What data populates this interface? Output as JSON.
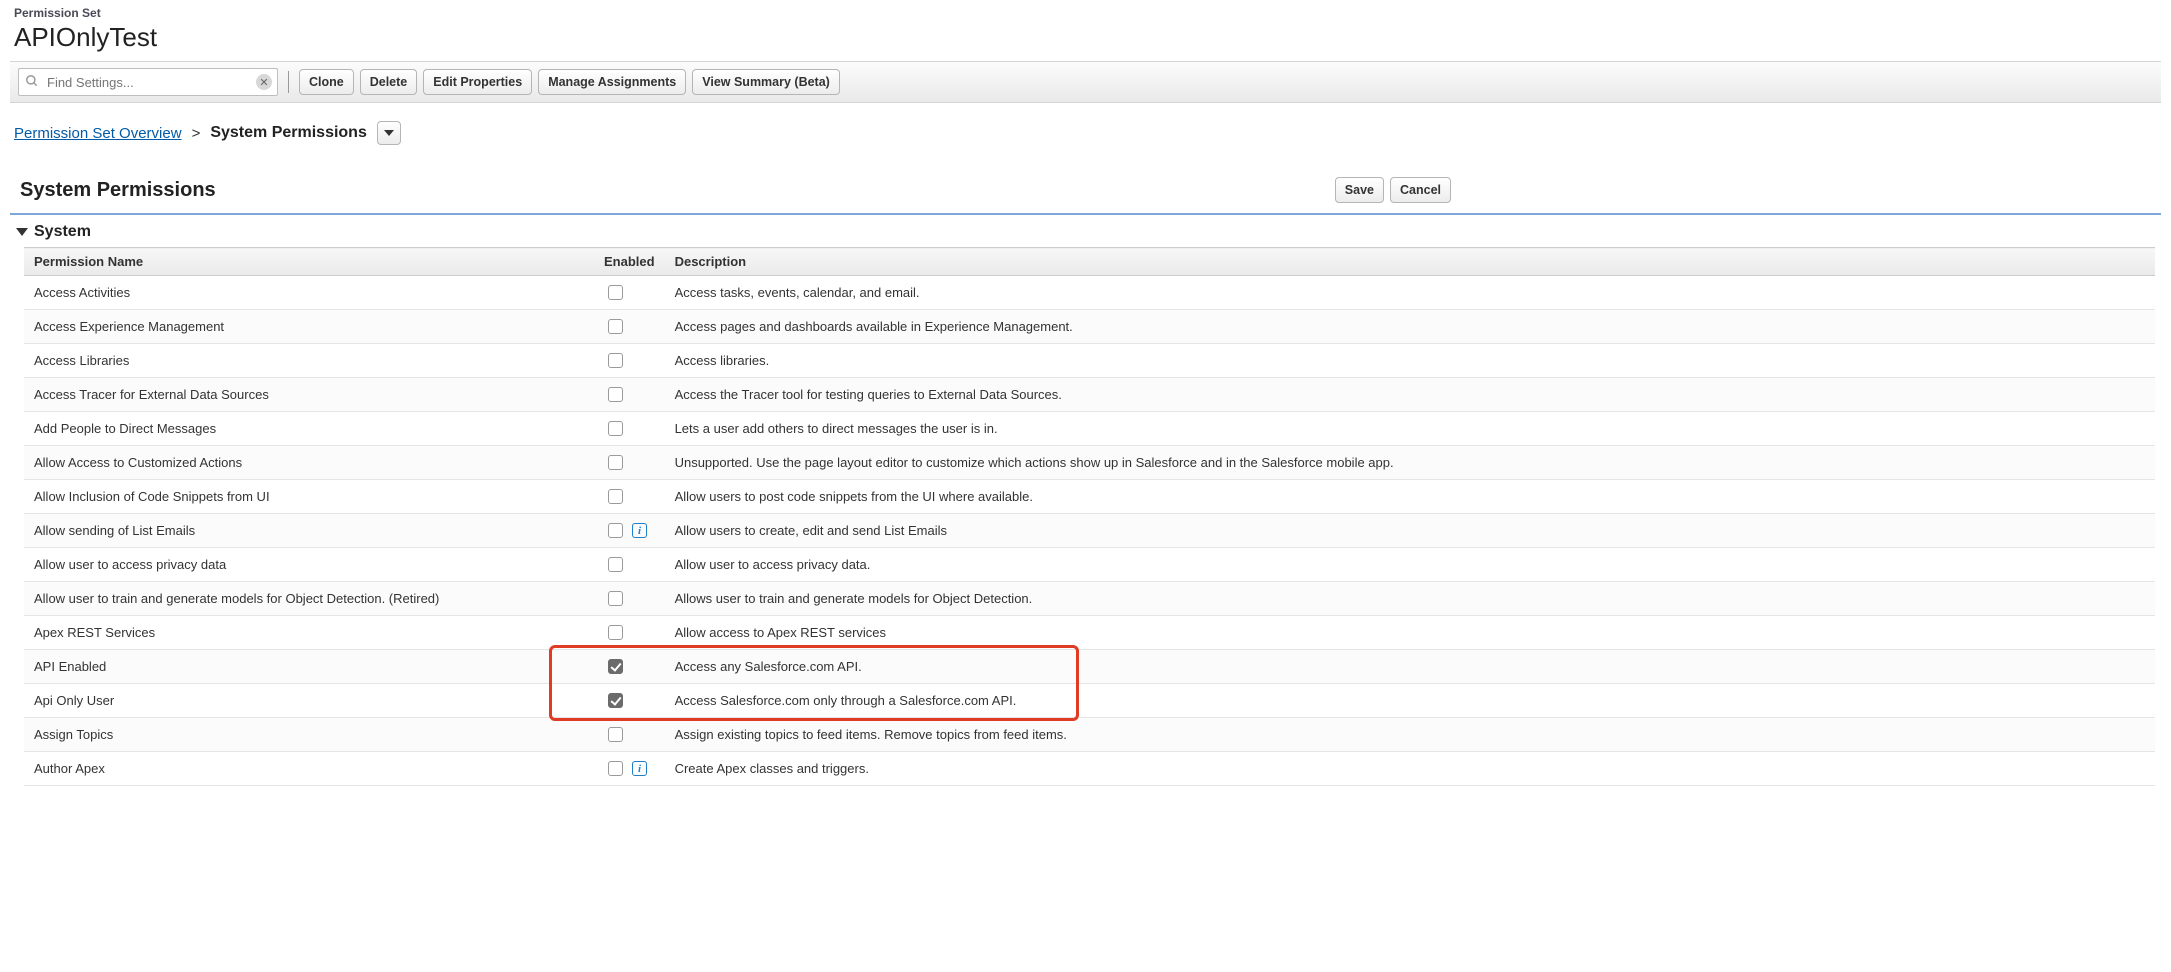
{
  "header": {
    "label": "Permission Set",
    "title": "APIOnlyTest"
  },
  "search": {
    "placeholder": "Find Settings..."
  },
  "toolbar": {
    "clone": "Clone",
    "delete": "Delete",
    "edit_properties": "Edit Properties",
    "manage_assignments": "Manage Assignments",
    "view_summary": "View Summary (Beta)"
  },
  "breadcrumb": {
    "overview": "Permission Set Overview",
    "current": "System Permissions"
  },
  "section": {
    "heading": "System Permissions",
    "save": "Save",
    "cancel": "Cancel",
    "group": "System"
  },
  "table": {
    "cols": {
      "name": "Permission Name",
      "enabled": "Enabled",
      "description": "Description"
    },
    "rows": [
      {
        "name": "Access Activities",
        "enabled": false,
        "info": false,
        "desc": "Access tasks, events, calendar, and email."
      },
      {
        "name": "Access Experience Management",
        "enabled": false,
        "info": false,
        "desc": "Access pages and dashboards available in Experience Management."
      },
      {
        "name": "Access Libraries",
        "enabled": false,
        "info": false,
        "desc": "Access libraries."
      },
      {
        "name": "Access Tracer for External Data Sources",
        "enabled": false,
        "info": false,
        "desc": "Access the Tracer tool for testing queries to External Data Sources."
      },
      {
        "name": "Add People to Direct Messages",
        "enabled": false,
        "info": false,
        "desc": "Lets a user add others to direct messages the user is in."
      },
      {
        "name": "Allow Access to Customized Actions",
        "enabled": false,
        "info": false,
        "desc": "Unsupported. Use the page layout editor to customize which actions show up in Salesforce and in the Salesforce mobile app."
      },
      {
        "name": "Allow Inclusion of Code Snippets from UI",
        "enabled": false,
        "info": false,
        "desc": "Allow users to post code snippets from the UI where available."
      },
      {
        "name": "Allow sending of List Emails",
        "enabled": false,
        "info": true,
        "desc": "Allow users to create, edit and send List Emails"
      },
      {
        "name": "Allow user to access privacy data",
        "enabled": false,
        "info": false,
        "desc": "Allow user to access privacy data."
      },
      {
        "name": "Allow user to train and generate models for Object Detection. (Retired)",
        "enabled": false,
        "info": false,
        "desc": "Allows user to train and generate models for Object Detection."
      },
      {
        "name": "Apex REST Services",
        "enabled": false,
        "info": false,
        "desc": "Allow access to Apex REST services"
      },
      {
        "name": "API Enabled",
        "enabled": true,
        "info": false,
        "desc": "Access any Salesforce.com API."
      },
      {
        "name": "Api Only User",
        "enabled": true,
        "info": false,
        "desc": "Access Salesforce.com only through a Salesforce.com API."
      },
      {
        "name": "Assign Topics",
        "enabled": false,
        "info": false,
        "desc": "Assign existing topics to feed items. Remove topics from feed items."
      },
      {
        "name": "Author Apex",
        "enabled": false,
        "info": true,
        "desc": "Create Apex classes and triggers."
      }
    ]
  },
  "highlight": {
    "top_row_index": 11,
    "row_count": 2
  }
}
